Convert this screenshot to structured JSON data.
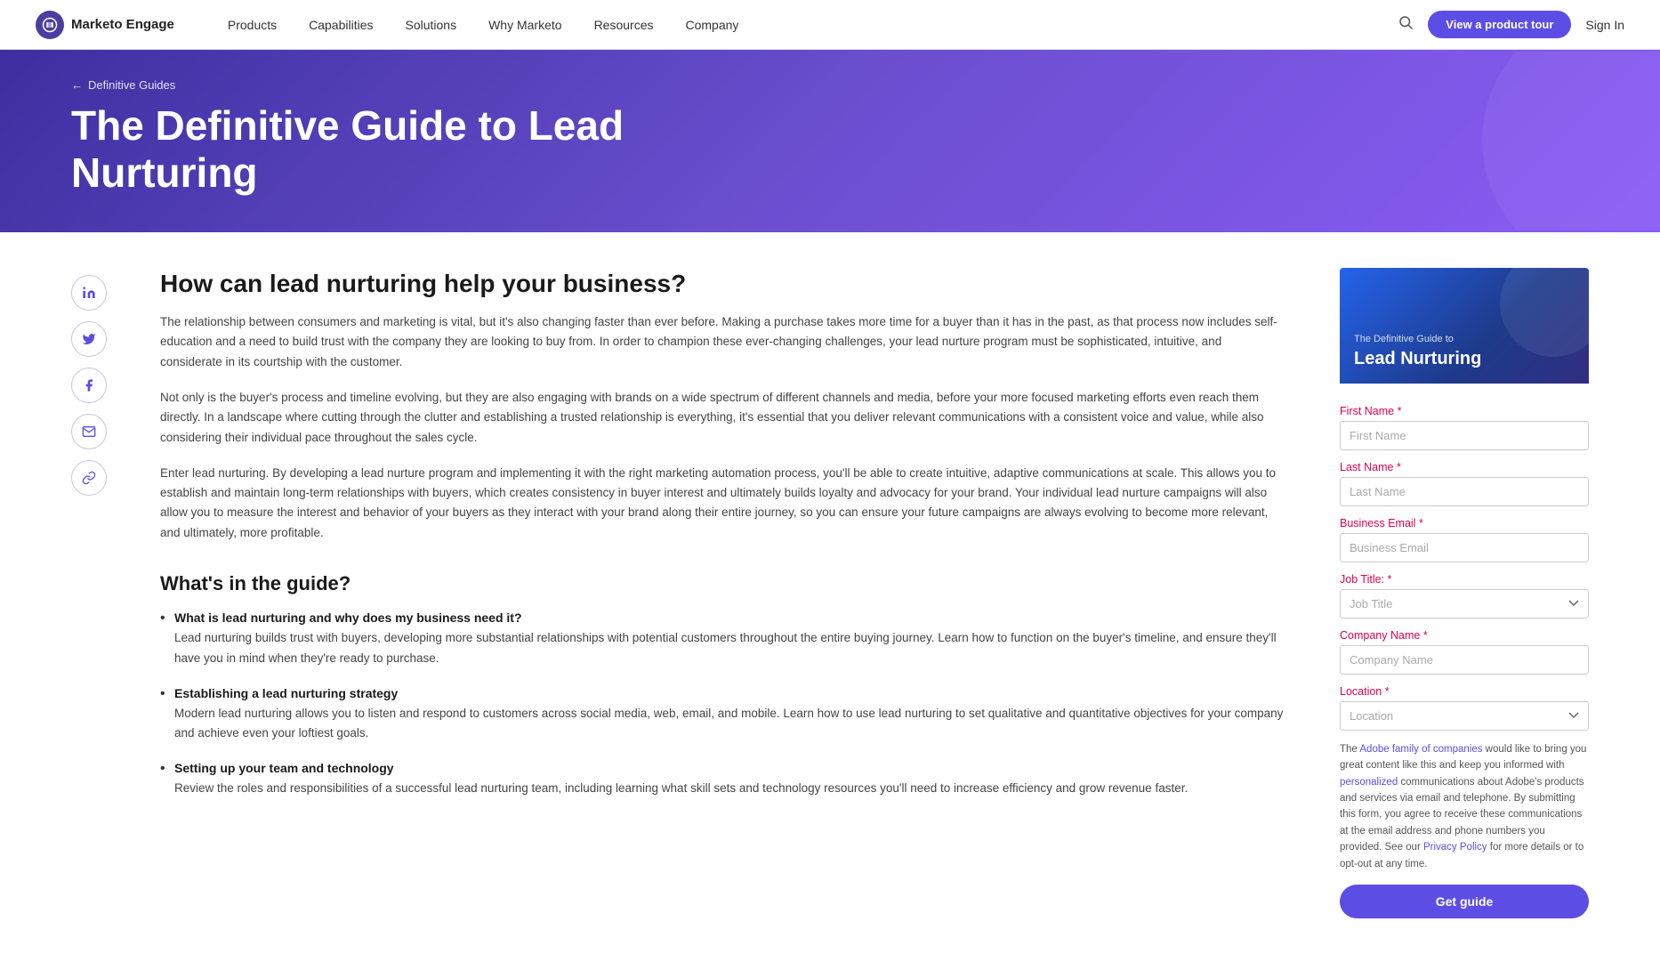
{
  "navbar": {
    "logo_icon": "M",
    "logo_text": "Marketo Engage",
    "nav_items": [
      {
        "label": "Products",
        "id": "products"
      },
      {
        "label": "Capabilities",
        "id": "capabilities"
      },
      {
        "label": "Solutions",
        "id": "solutions"
      },
      {
        "label": "Why Marketo",
        "id": "why-marketo"
      },
      {
        "label": "Resources",
        "id": "resources"
      },
      {
        "label": "Company",
        "id": "company"
      }
    ],
    "product_tour_label": "View a product tour",
    "sign_in_label": "Sign In"
  },
  "hero": {
    "breadcrumb_arrow": "←",
    "breadcrumb_label": "Definitive Guides",
    "title": "The Definitive Guide to Lead Nurturing"
  },
  "social": {
    "items": [
      {
        "icon": "in",
        "label": "linkedin",
        "name": "linkedin-icon"
      },
      {
        "icon": "🐦",
        "label": "twitter",
        "name": "twitter-icon"
      },
      {
        "icon": "f",
        "label": "facebook",
        "name": "facebook-icon"
      },
      {
        "icon": "✉",
        "label": "email",
        "name": "email-icon"
      },
      {
        "icon": "🔗",
        "label": "link",
        "name": "link-icon"
      }
    ]
  },
  "article": {
    "section1_title": "How can lead nurturing help your business?",
    "paragraph1": "The relationship between consumers and marketing is vital, but it's also changing faster than ever before. Making a purchase takes more time for a buyer than it has in the past, as that process now includes self-education and a need to build trust with the company they are looking to buy from. In order to champion these ever-changing challenges, your lead nurture program must be sophisticated, intuitive, and considerate in its courtship with the customer.",
    "paragraph2": "Not only is the buyer's process and timeline evolving, but they are also engaging with brands on a wide spectrum of different channels and media, before your more focused marketing efforts even reach them directly. In a landscape where cutting through the clutter and establishing a trusted relationship is everything, it's essential that you deliver relevant communications with a consistent voice and value, while also considering their individual pace throughout the sales cycle.",
    "paragraph3": "Enter lead nurturing. By developing a lead nurture program and implementing it with the right marketing automation process, you'll be able to create intuitive, adaptive communications at scale. This allows you to establish and maintain long-term relationships with buyers, which creates consistency in buyer interest and ultimately builds loyalty and advocacy for your brand. Your individual lead nurture campaigns will also allow you to measure the interest and behavior of your buyers as they interact with your brand along their entire journey, so you can ensure your future campaigns are always evolving to become more relevant, and ultimately, more profitable.",
    "section2_title": "What's in the guide?",
    "bullet_items": [
      {
        "title": "What is lead nurturing and why does my business need it?",
        "text": "Lead nurturing builds trust with buyers, developing more substantial relationships with potential customers throughout the entire buying journey. Learn how to function on the buyer's timeline, and ensure they'll have you in mind when they're ready to purchase."
      },
      {
        "title": "Establishing a lead nurturing strategy",
        "text": "Modern lead nurturing allows you to listen and respond to customers across social media, web, email, and mobile. Learn how to use lead nurturing to set qualitative and quantitative objectives for your company and achieve even your loftiest goals."
      },
      {
        "title": "Setting up your team and technology",
        "text": "Review the roles and responsibilities of a successful lead nurturing team, including learning what skill sets and technology resources you'll need to increase efficiency and grow revenue faster."
      }
    ]
  },
  "guide_card": {
    "subtitle": "The Definitive Guide to",
    "title": "Lead Nurturing"
  },
  "form": {
    "first_name_label": "First Name",
    "first_name_required": "*",
    "first_name_placeholder": "First Name",
    "last_name_label": "Last Name",
    "last_name_required": "*",
    "last_name_placeholder": "Last Name",
    "email_label": "Business Email",
    "email_required": "*",
    "email_placeholder": "Business Email",
    "job_title_label": "Job Title:",
    "job_title_required": "*",
    "job_title_placeholder": "Job Title",
    "company_name_label": "Company Name",
    "company_name_required": "*",
    "company_name_placeholder": "Company Name",
    "location_label": "Location",
    "location_required": "*",
    "location_placeholder": "Location",
    "privacy_text_before": "The ",
    "privacy_link1_text": "Adobe family of companies",
    "privacy_text_mid1": " would like to bring you great content like this and keep you informed with ",
    "privacy_link2_text": "personalized",
    "privacy_text_mid2": " communications about Adobe's products and services via email and telephone. By submitting this form, you agree to receive these communications at the email address and phone numbers you provided. See our ",
    "privacy_link3_text": "Privacy Policy",
    "privacy_text_end": " for more details or to opt-out at any time.",
    "submit_label": "Get guide"
  }
}
